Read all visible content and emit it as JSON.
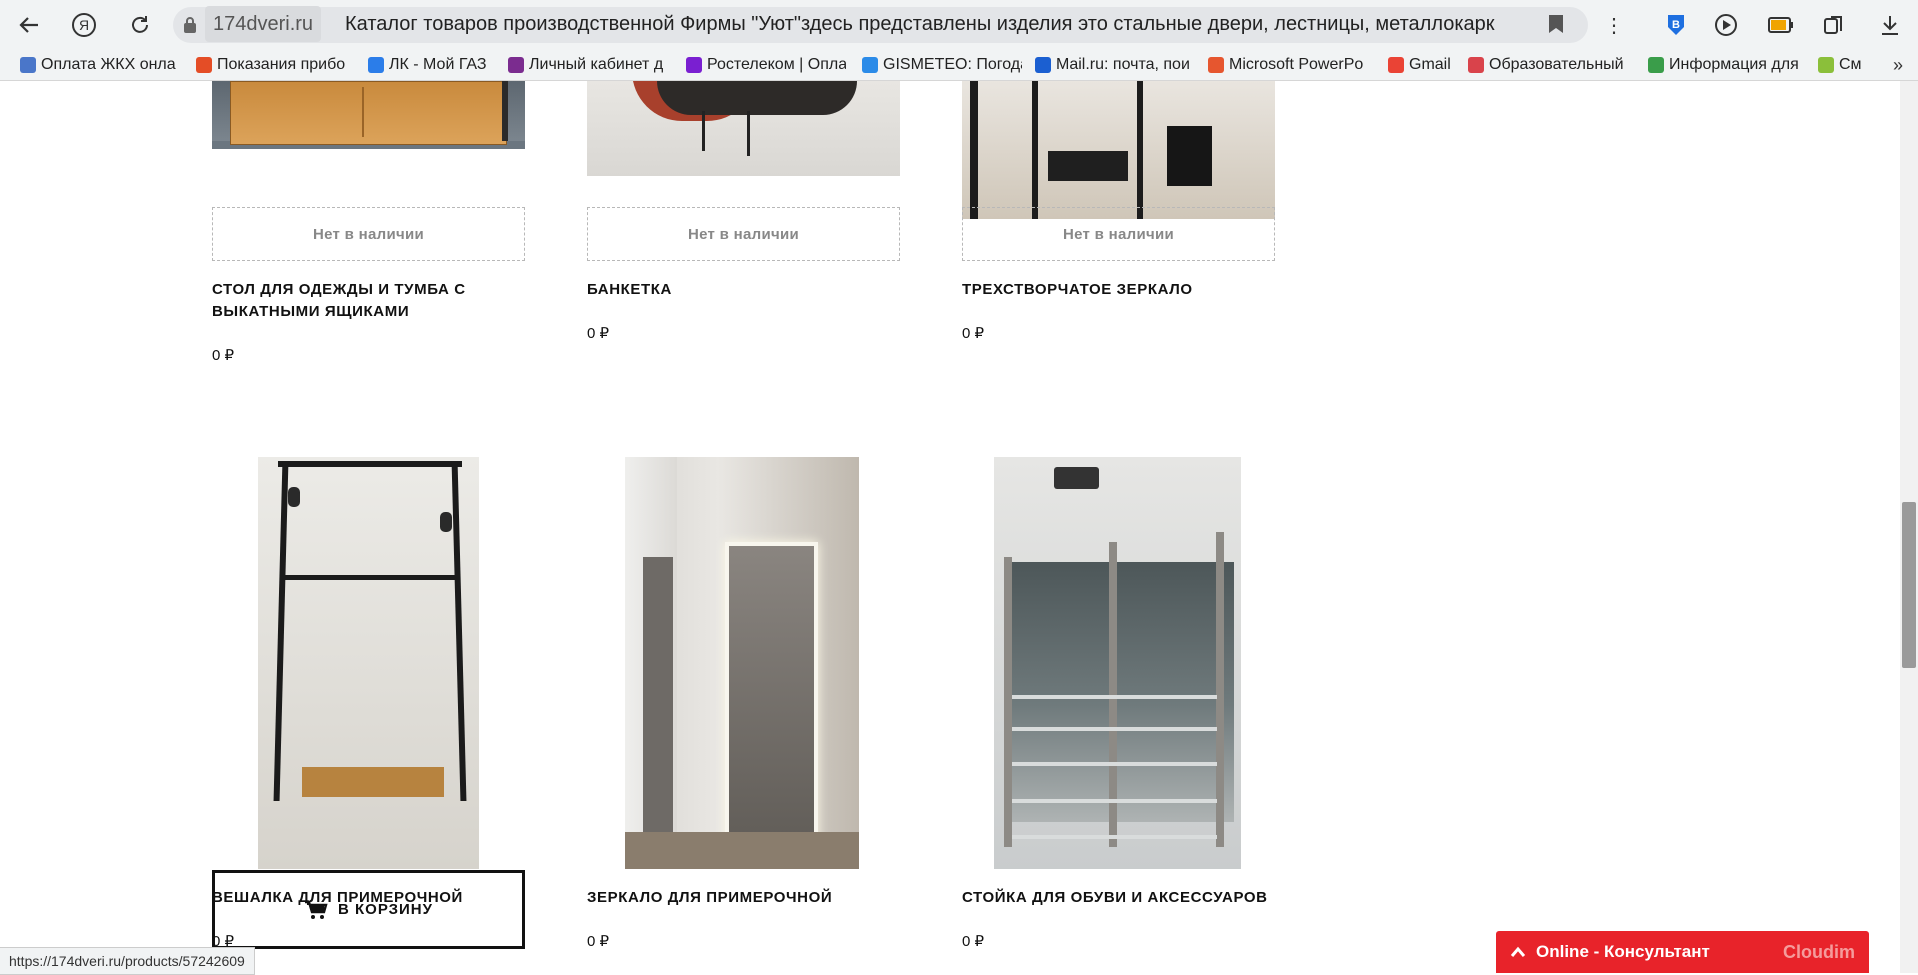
{
  "browser": {
    "domain": "174dveri.ru",
    "tab_title": "Каталог товаров производственной Фирмы \"Уют\"здесь представлены изделия это стальные двери, лестницы, металлокарк...",
    "bookmarks": [
      {
        "label": "Оплата ЖКХ онла",
        "color": "#4a76c9"
      },
      {
        "label": "Показания прибо",
        "color": "#e44d26"
      },
      {
        "label": "ЛК - Мой ГАЗ",
        "color": "#2b7de9"
      },
      {
        "label": "Личный кабинет д",
        "color": "#7b2c8f"
      },
      {
        "label": "Ростелеком | Опла",
        "color": "#7a1fd1"
      },
      {
        "label": "GISMETEO: Погода",
        "color": "#2b8be8"
      },
      {
        "label": "Mail.ru: почта, пои",
        "color": "#1b5fd1"
      },
      {
        "label": "Microsoft PowerPo",
        "color": "#e6562f"
      },
      {
        "label": "Gmail",
        "color": "#ea4335"
      },
      {
        "label": "Образовательный",
        "color": "#d9434b"
      },
      {
        "label": "Информация для",
        "color": "#3a9d4a"
      },
      {
        "label": "См",
        "color": "#8bbf3a"
      }
    ],
    "status_url": "https://174dveri.ru/products/57242609"
  },
  "products_top": [
    {
      "name": "СТОЛ ДЛЯ ОДЕЖДЫ И ТУМБА С ВЫКАТНЫМИ ЯЩИКАМИ",
      "stock": "Нет в наличии",
      "price": "0 ₽"
    },
    {
      "name": "БАНКЕТКА",
      "stock": "Нет в наличии",
      "price": "0 ₽"
    },
    {
      "name": "ТРЕХСТВОРЧАТОЕ ЗЕРКАЛО",
      "stock": "Нет в наличии",
      "price": "0 ₽"
    }
  ],
  "products_bottom": [
    {
      "name": "ВЕШАЛКА ДЛЯ ПРИМЕРОЧНОЙ",
      "price": "0 ₽"
    },
    {
      "name": "ЗЕРКАЛО ДЛЯ ПРИМЕРОЧНОЙ",
      "price": "0 ₽"
    },
    {
      "name": "СТОЙКА ДЛЯ ОБУВИ И АКСЕССУАРОВ",
      "price": "0 ₽"
    }
  ],
  "cart_button_label": "В КОРЗИНУ",
  "consultant": {
    "label": "Online - Консультант",
    "brand": "Cloudim"
  }
}
